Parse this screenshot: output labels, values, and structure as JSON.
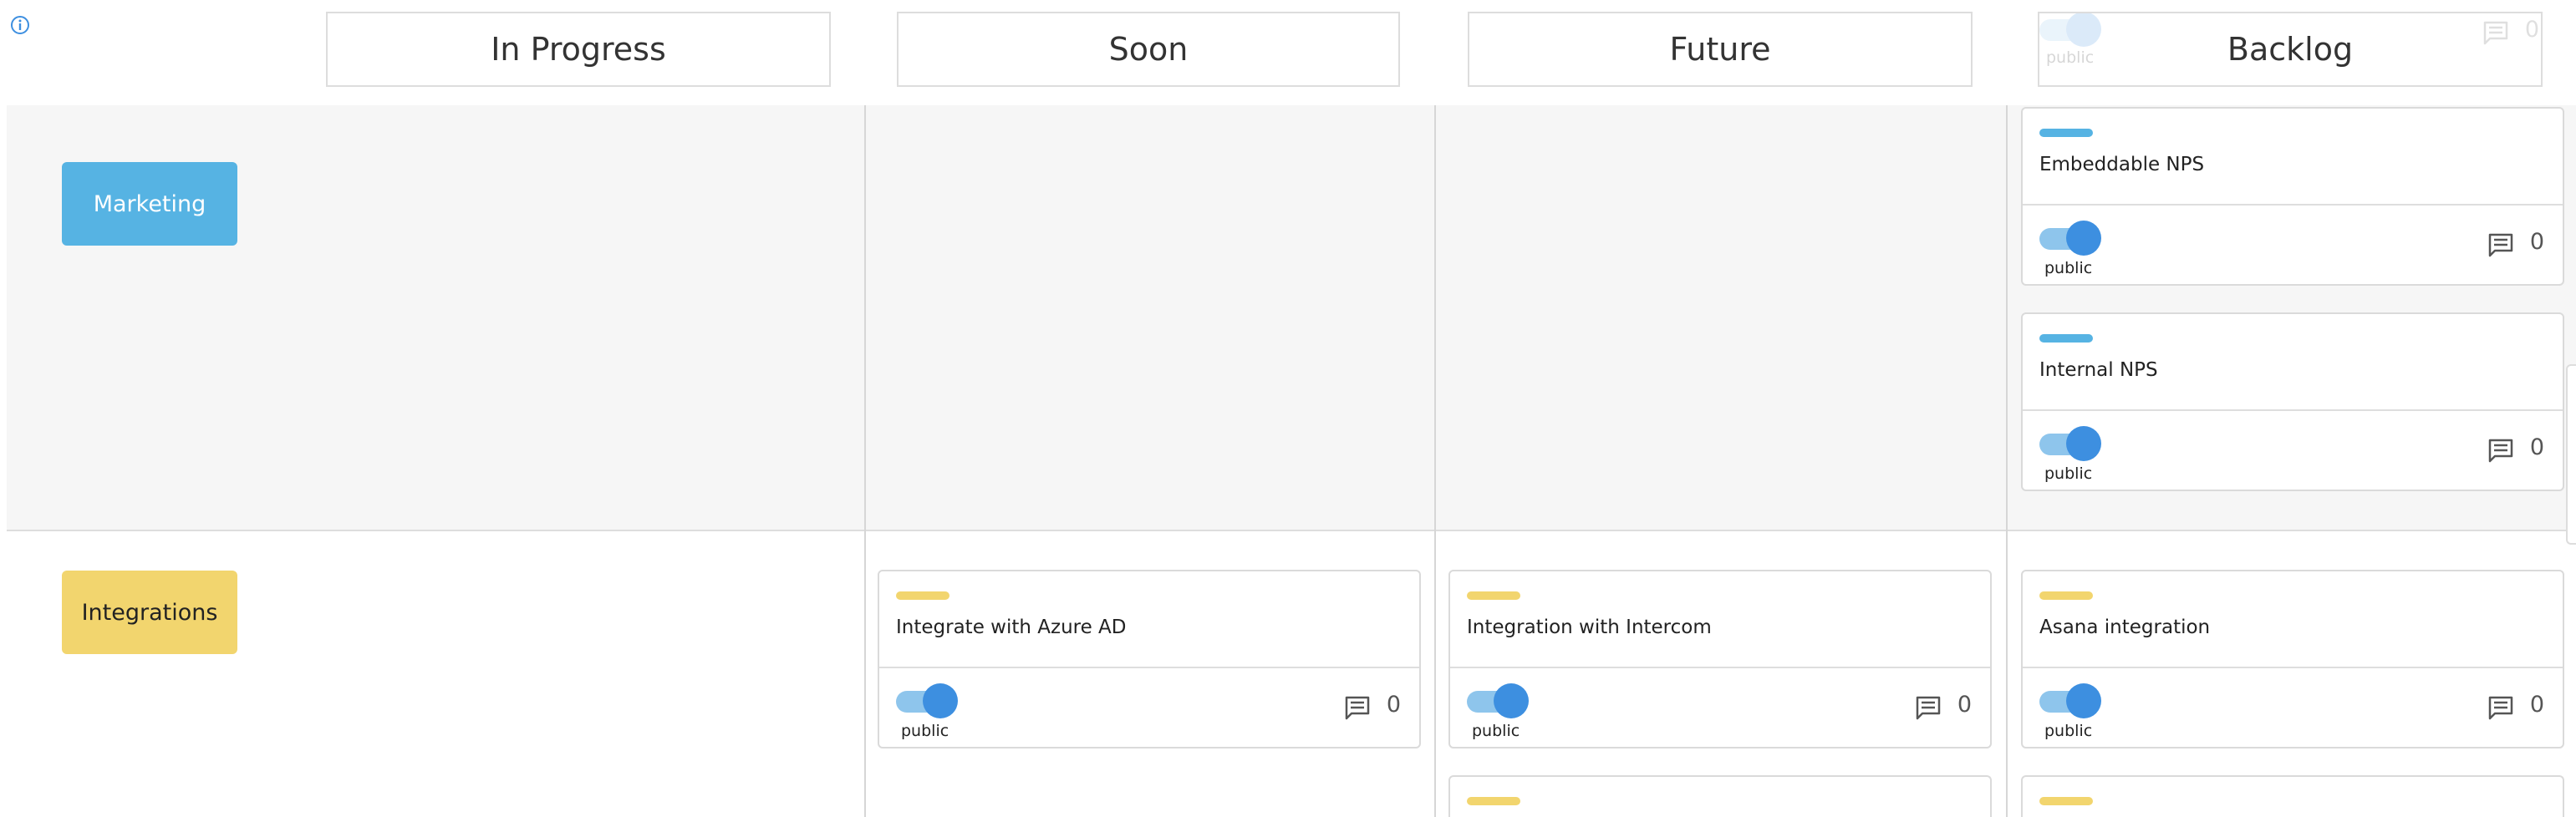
{
  "columns": [
    "In Progress",
    "Soon",
    "Future",
    "Backlog"
  ],
  "rows": {
    "marketing": {
      "label": "Marketing",
      "color": "#56b3e3",
      "cards": [
        {
          "title": "Embeddable NPS",
          "toggle_label": "public",
          "comments": "0"
        },
        {
          "title": "Internal NPS",
          "toggle_label": "public",
          "comments": "0"
        }
      ]
    },
    "integrations": {
      "label": "Integrations",
      "color": "#f2d56e",
      "cards": [
        {
          "title": "Integrate with Azure AD",
          "toggle_label": "public",
          "comments": "0"
        },
        {
          "title": "Integration with Intercom",
          "toggle_label": "public",
          "comments": "0"
        },
        {
          "title": "Asana integration",
          "toggle_label": "public",
          "comments": "0"
        }
      ]
    }
  },
  "ghost_card": {
    "toggle_label": "public",
    "comments": "0"
  },
  "colors": {
    "toggle_track": "#8ec5ec",
    "toggle_knob": "#3d8fe0",
    "border": "#dadada",
    "row_alt_bg": "#f6f6f6"
  }
}
